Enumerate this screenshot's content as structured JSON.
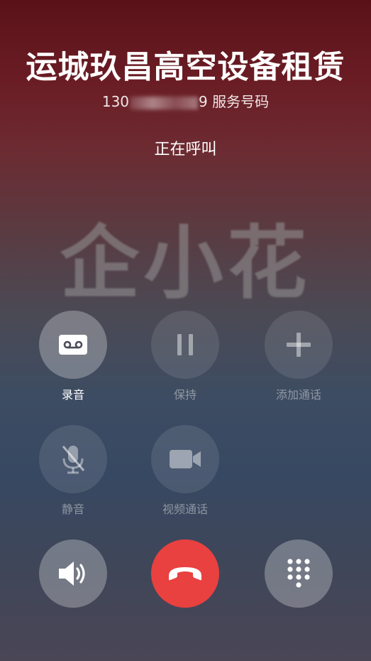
{
  "call": {
    "name": "运城玖昌高空设备租赁",
    "number_prefix": "130",
    "number_suffix": "9",
    "number_tag": "服务号码",
    "status": "正在呼叫",
    "watermark": "企小花"
  },
  "actions": [
    {
      "label": "录音",
      "icon": "cassette-record-icon",
      "enabled": true
    },
    {
      "label": "保持",
      "icon": "pause-icon",
      "enabled": false
    },
    {
      "label": "添加通话",
      "icon": "plus-icon",
      "enabled": false
    },
    {
      "label": "静音",
      "icon": "mic-off-icon",
      "enabled": false
    },
    {
      "label": "视频通话",
      "icon": "video-camera-icon",
      "enabled": false
    }
  ],
  "controls": {
    "speaker_icon": "speaker-icon",
    "hangup_icon": "phone-hangup-icon",
    "dialpad_icon": "dialpad-icon",
    "hangup_color": "#e94040"
  }
}
